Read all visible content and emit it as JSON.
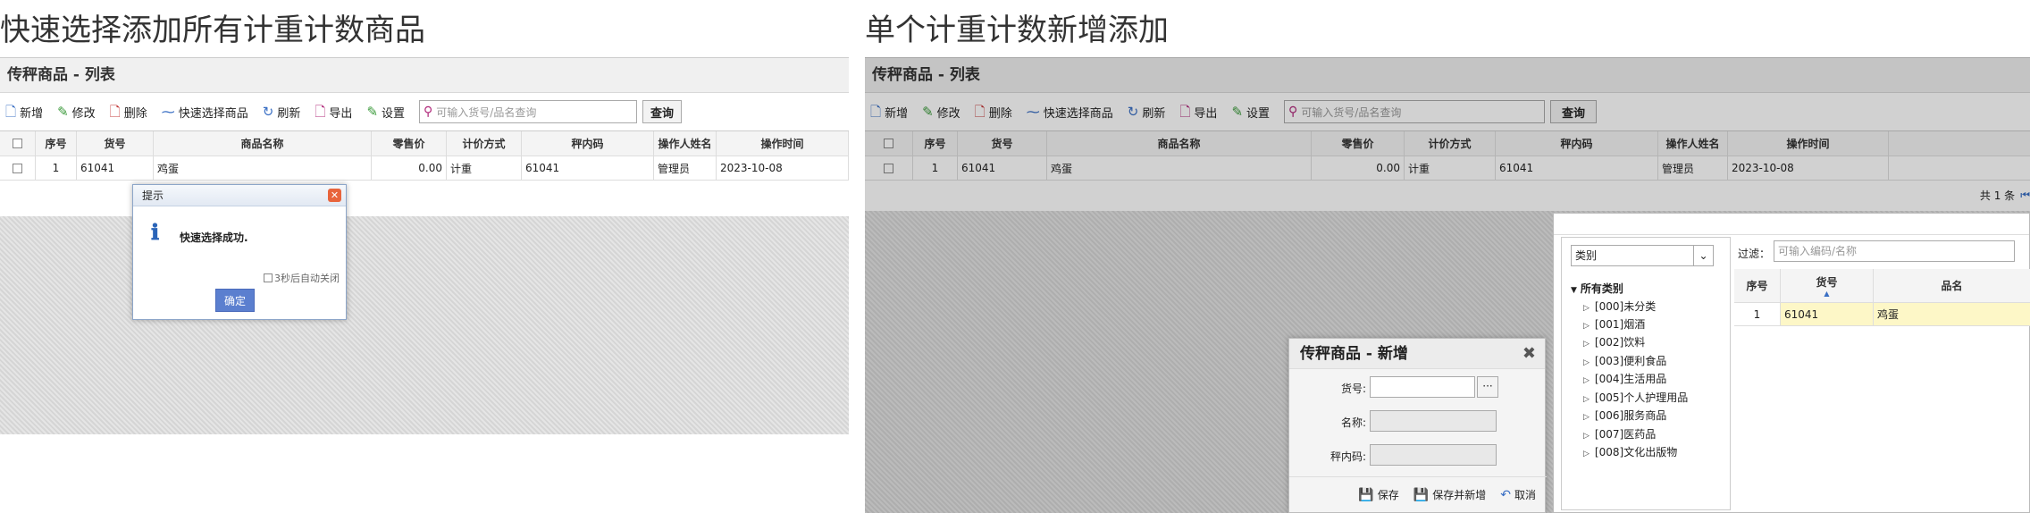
{
  "captions": {
    "left": "快速选择添加所有计重计数商品",
    "right": "单个计重计数新增添加"
  },
  "panel_title": "传秤商品 - 列表",
  "toolbar": {
    "items": [
      {
        "label": "新增",
        "icon": "add-icon",
        "color": "#3a6fc4"
      },
      {
        "label": "修改",
        "icon": "edit-icon",
        "color": "#3a9a3a"
      },
      {
        "label": "删除",
        "icon": "delete-icon",
        "color": "#c43a3a"
      },
      {
        "label": "快速选择商品",
        "icon": "quick-select-icon",
        "color": "#3a6fc4"
      },
      {
        "label": "刷新",
        "icon": "refresh-icon",
        "color": "#3a6fc4"
      },
      {
        "label": "导出",
        "icon": "export-icon",
        "color": "#b0287a"
      },
      {
        "label": "设置",
        "icon": "settings-icon",
        "color": "#3a9a3a"
      }
    ],
    "search_placeholder": "可输入货号/品名查询",
    "query_label": "查询"
  },
  "table": {
    "headers": [
      "序号",
      "货号",
      "商品名称",
      "零售价",
      "计价方式",
      "秤内码",
      "操作人姓名",
      "操作时间"
    ],
    "rows": [
      [
        "1",
        "61041",
        "鸡蛋",
        "0.00",
        "计重",
        "61041",
        "管理员",
        "2023-10-08"
      ]
    ]
  },
  "tip_dialog": {
    "title": "提示",
    "message": "快速选择成功.",
    "auto_close": "3秒后自动关闭",
    "ok_label": "确定"
  },
  "pager_text": "共 1 条",
  "picker": {
    "category_select": "类别",
    "tree_root": "所有类别",
    "categories": [
      "[000]未分类",
      "[001]烟酒",
      "[002]饮料",
      "[003]便利食品",
      "[004]生活用品",
      "[005]个人护理用品",
      "[006]服务商品",
      "[007]医药品",
      "[008]文化出版物"
    ],
    "filter_label": "过滤：",
    "filter_placeholder": "可输入编码/名称",
    "headers": [
      "序号",
      "货号",
      "品名"
    ],
    "rows": [
      [
        "1",
        "61041",
        "鸡蛋"
      ]
    ]
  },
  "add_dialog": {
    "title": "传秤商品 - 新增",
    "fields": {
      "code": "货号:",
      "name": "名称:",
      "scale_code": "秤内码:"
    },
    "more": "···",
    "save": "保存",
    "save_new": "保存并新增",
    "cancel": "取消"
  },
  "colors": {
    "selected_row": "#fdf7c7",
    "ok_button": "#5b7fcf",
    "close_button": "#e8643c"
  }
}
